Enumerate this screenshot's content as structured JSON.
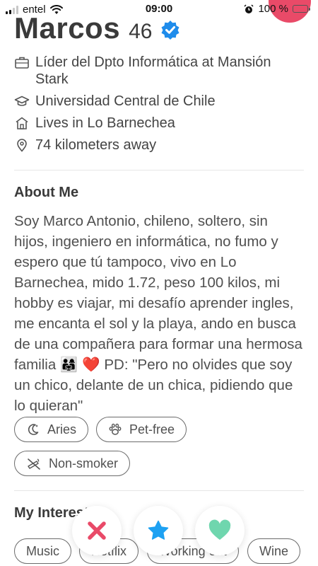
{
  "status_bar": {
    "carrier": "entel",
    "time": "09:00",
    "battery": "100 %"
  },
  "profile": {
    "name": "Marcos",
    "age": "46",
    "job": "Líder del Dpto Informática at Mansión Stark",
    "school": "Universidad Central de Chile",
    "lives": "Lives in Lo Barnechea",
    "distance": "74 kilometers away"
  },
  "about": {
    "title": "About Me",
    "text": "Soy Marco Antonio, chileno, soltero, sin hijos, ingeniero en informática, no fumo y espero que tú tampoco, vivo en Lo Barnechea, mido 1.72, peso 100 kilos, mi hobby es viajar, mi desafío aprender ingles, me encanta el sol y la playa, ando en busca de una compañera para formar una hermosa familia 👨‍👩‍👧 ❤️ PD: \"Pero no olvides que soy un chico, delante de un chica, pidiendo que lo quieran\""
  },
  "basics": [
    {
      "label": "Aries",
      "icon": "moon-icon"
    },
    {
      "label": "Pet-free",
      "icon": "paw-icon"
    },
    {
      "label": "Non-smoker",
      "icon": "no-smoking-icon"
    }
  ],
  "interests": {
    "title": "My Interests",
    "items": [
      "Music",
      "Netflix",
      "Working out",
      "Wine"
    ]
  },
  "actions": {
    "nope_icon": "x-icon",
    "super_like_icon": "star-icon",
    "like_icon": "heart-icon"
  },
  "colors": {
    "nope": "#e94a68",
    "super_like": "#1da1f2",
    "like": "#6fd6ae",
    "verified": "#1f8ceb",
    "battery": "#35c759"
  }
}
